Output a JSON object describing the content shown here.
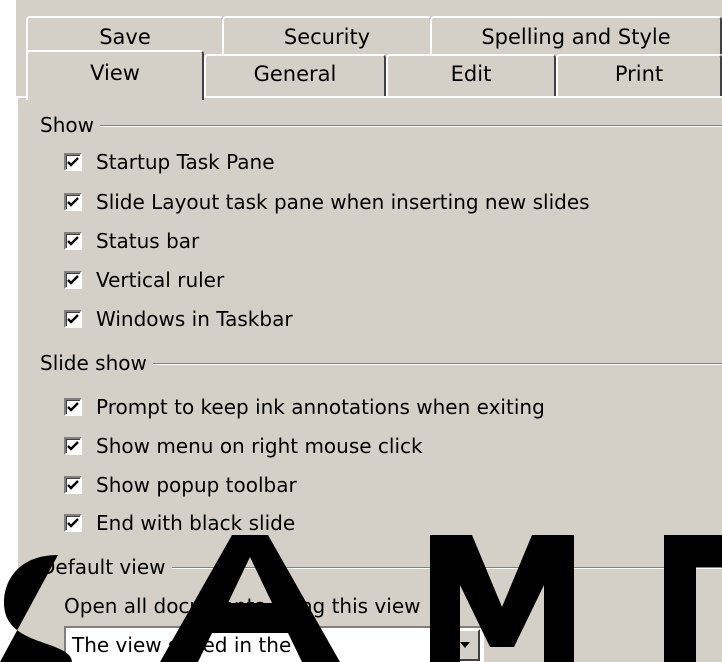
{
  "tabs": {
    "back": [
      {
        "label": "Save"
      },
      {
        "label": "Security"
      },
      {
        "label": "Spelling and Style"
      }
    ],
    "front": [
      {
        "label": "View"
      },
      {
        "label": "General"
      },
      {
        "label": "Edit"
      },
      {
        "label": "Print"
      }
    ],
    "active": "View"
  },
  "show": {
    "label": "Show",
    "items": [
      {
        "label": "Startup Task Pane",
        "checked": true
      },
      {
        "label": "Slide Layout task pane when inserting new slides",
        "checked": true
      },
      {
        "label": "Status bar",
        "checked": true
      },
      {
        "label": "Vertical ruler",
        "checked": true
      },
      {
        "label": "Windows in Taskbar",
        "checked": true
      }
    ]
  },
  "slideshow": {
    "label": "Slide show",
    "items": [
      {
        "label": "Prompt to keep ink annotations when exiting",
        "checked": true
      },
      {
        "label": "Show menu on right mouse click",
        "checked": true
      },
      {
        "label": "Show popup toolbar",
        "checked": true
      },
      {
        "label": "End with black slide",
        "checked": true
      }
    ]
  },
  "default_view": {
    "label": "Default view",
    "open_label": "Open all documents using this view",
    "selected": "The view saved in the file"
  },
  "watermark": {
    "text": "SAMPLE",
    "color": "#000000"
  },
  "colors": {
    "face": "#d4d0c8",
    "highlight": "#ffffff",
    "shadow": "#808080",
    "dark_shadow": "#404040"
  }
}
